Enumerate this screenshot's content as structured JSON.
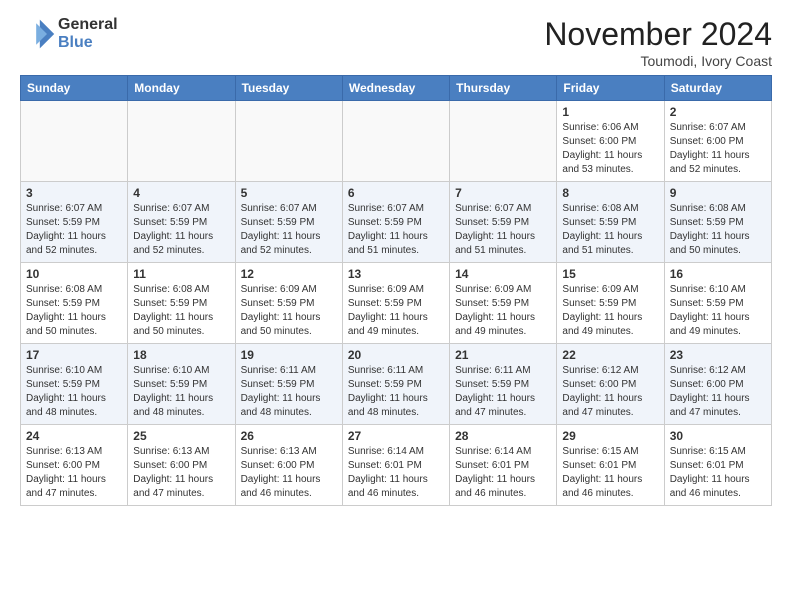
{
  "logo": {
    "general": "General",
    "blue": "Blue"
  },
  "title": "November 2024",
  "subtitle": "Toumodi, Ivory Coast",
  "headers": [
    "Sunday",
    "Monday",
    "Tuesday",
    "Wednesday",
    "Thursday",
    "Friday",
    "Saturday"
  ],
  "weeks": [
    [
      {
        "day": "",
        "info": ""
      },
      {
        "day": "",
        "info": ""
      },
      {
        "day": "",
        "info": ""
      },
      {
        "day": "",
        "info": ""
      },
      {
        "day": "",
        "info": ""
      },
      {
        "day": "1",
        "info": "Sunrise: 6:06 AM\nSunset: 6:00 PM\nDaylight: 11 hours\nand 53 minutes."
      },
      {
        "day": "2",
        "info": "Sunrise: 6:07 AM\nSunset: 6:00 PM\nDaylight: 11 hours\nand 52 minutes."
      }
    ],
    [
      {
        "day": "3",
        "info": "Sunrise: 6:07 AM\nSunset: 5:59 PM\nDaylight: 11 hours\nand 52 minutes."
      },
      {
        "day": "4",
        "info": "Sunrise: 6:07 AM\nSunset: 5:59 PM\nDaylight: 11 hours\nand 52 minutes."
      },
      {
        "day": "5",
        "info": "Sunrise: 6:07 AM\nSunset: 5:59 PM\nDaylight: 11 hours\nand 52 minutes."
      },
      {
        "day": "6",
        "info": "Sunrise: 6:07 AM\nSunset: 5:59 PM\nDaylight: 11 hours\nand 51 minutes."
      },
      {
        "day": "7",
        "info": "Sunrise: 6:07 AM\nSunset: 5:59 PM\nDaylight: 11 hours\nand 51 minutes."
      },
      {
        "day": "8",
        "info": "Sunrise: 6:08 AM\nSunset: 5:59 PM\nDaylight: 11 hours\nand 51 minutes."
      },
      {
        "day": "9",
        "info": "Sunrise: 6:08 AM\nSunset: 5:59 PM\nDaylight: 11 hours\nand 50 minutes."
      }
    ],
    [
      {
        "day": "10",
        "info": "Sunrise: 6:08 AM\nSunset: 5:59 PM\nDaylight: 11 hours\nand 50 minutes."
      },
      {
        "day": "11",
        "info": "Sunrise: 6:08 AM\nSunset: 5:59 PM\nDaylight: 11 hours\nand 50 minutes."
      },
      {
        "day": "12",
        "info": "Sunrise: 6:09 AM\nSunset: 5:59 PM\nDaylight: 11 hours\nand 50 minutes."
      },
      {
        "day": "13",
        "info": "Sunrise: 6:09 AM\nSunset: 5:59 PM\nDaylight: 11 hours\nand 49 minutes."
      },
      {
        "day": "14",
        "info": "Sunrise: 6:09 AM\nSunset: 5:59 PM\nDaylight: 11 hours\nand 49 minutes."
      },
      {
        "day": "15",
        "info": "Sunrise: 6:09 AM\nSunset: 5:59 PM\nDaylight: 11 hours\nand 49 minutes."
      },
      {
        "day": "16",
        "info": "Sunrise: 6:10 AM\nSunset: 5:59 PM\nDaylight: 11 hours\nand 49 minutes."
      }
    ],
    [
      {
        "day": "17",
        "info": "Sunrise: 6:10 AM\nSunset: 5:59 PM\nDaylight: 11 hours\nand 48 minutes."
      },
      {
        "day": "18",
        "info": "Sunrise: 6:10 AM\nSunset: 5:59 PM\nDaylight: 11 hours\nand 48 minutes."
      },
      {
        "day": "19",
        "info": "Sunrise: 6:11 AM\nSunset: 5:59 PM\nDaylight: 11 hours\nand 48 minutes."
      },
      {
        "day": "20",
        "info": "Sunrise: 6:11 AM\nSunset: 5:59 PM\nDaylight: 11 hours\nand 48 minutes."
      },
      {
        "day": "21",
        "info": "Sunrise: 6:11 AM\nSunset: 5:59 PM\nDaylight: 11 hours\nand 47 minutes."
      },
      {
        "day": "22",
        "info": "Sunrise: 6:12 AM\nSunset: 6:00 PM\nDaylight: 11 hours\nand 47 minutes."
      },
      {
        "day": "23",
        "info": "Sunrise: 6:12 AM\nSunset: 6:00 PM\nDaylight: 11 hours\nand 47 minutes."
      }
    ],
    [
      {
        "day": "24",
        "info": "Sunrise: 6:13 AM\nSunset: 6:00 PM\nDaylight: 11 hours\nand 47 minutes."
      },
      {
        "day": "25",
        "info": "Sunrise: 6:13 AM\nSunset: 6:00 PM\nDaylight: 11 hours\nand 47 minutes."
      },
      {
        "day": "26",
        "info": "Sunrise: 6:13 AM\nSunset: 6:00 PM\nDaylight: 11 hours\nand 46 minutes."
      },
      {
        "day": "27",
        "info": "Sunrise: 6:14 AM\nSunset: 6:01 PM\nDaylight: 11 hours\nand 46 minutes."
      },
      {
        "day": "28",
        "info": "Sunrise: 6:14 AM\nSunset: 6:01 PM\nDaylight: 11 hours\nand 46 minutes."
      },
      {
        "day": "29",
        "info": "Sunrise: 6:15 AM\nSunset: 6:01 PM\nDaylight: 11 hours\nand 46 minutes."
      },
      {
        "day": "30",
        "info": "Sunrise: 6:15 AM\nSunset: 6:01 PM\nDaylight: 11 hours\nand 46 minutes."
      }
    ]
  ]
}
